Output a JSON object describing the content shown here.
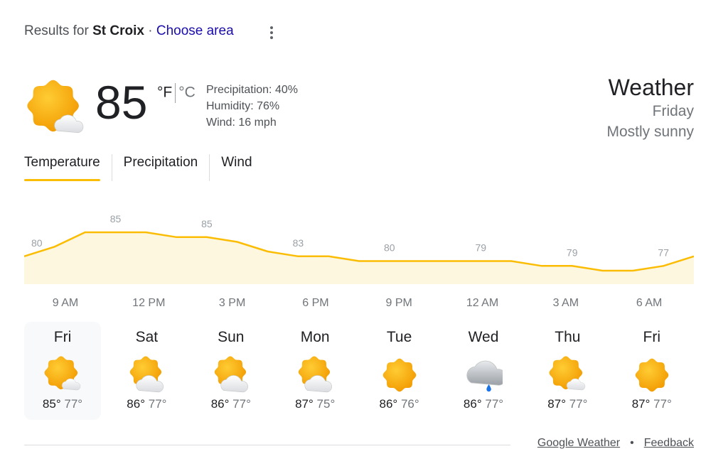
{
  "header": {
    "results_prefix": "Results for",
    "location": "St Croix",
    "separator": "·",
    "choose_area": "Choose area"
  },
  "current": {
    "icon": "partly-sunny-icon",
    "temperature": "85",
    "unit_f": "°F",
    "unit_c": "°C",
    "precipitation": "Precipitation: 40%",
    "humidity": "Humidity: 76%",
    "wind": "Wind: 16 mph"
  },
  "summary": {
    "title": "Weather",
    "day": "Friday",
    "condition": "Mostly sunny"
  },
  "tabs": [
    {
      "label": "Temperature",
      "active": true
    },
    {
      "label": "Precipitation",
      "active": false
    },
    {
      "label": "Wind",
      "active": false
    }
  ],
  "chart_data": {
    "type": "area",
    "values": [
      80,
      82,
      85,
      85,
      85,
      84,
      84,
      83,
      81,
      80,
      80,
      79,
      79,
      79,
      79,
      79,
      79,
      78,
      78,
      77,
      77,
      78,
      80
    ],
    "point_labels": [
      "80",
      "85",
      "85",
      "83",
      "80",
      "79",
      "79",
      "77"
    ],
    "x_tick_labels": [
      "9 AM",
      "12 PM",
      "3 PM",
      "6 PM",
      "9 PM",
      "12 AM",
      "3 AM",
      "6 AM"
    ],
    "ylim": [
      70,
      90
    ],
    "line_color": "#fbbc04",
    "fill_color": "#fef7e0"
  },
  "days": [
    {
      "name": "Fri",
      "icon": "partly-sunny-icon",
      "high": "85°",
      "low": "77°",
      "selected": true
    },
    {
      "name": "Sat",
      "icon": "partly-cloudy-icon",
      "high": "86°",
      "low": "77°",
      "selected": false
    },
    {
      "name": "Sun",
      "icon": "partly-cloudy-icon",
      "high": "86°",
      "low": "77°",
      "selected": false
    },
    {
      "name": "Mon",
      "icon": "partly-cloudy-icon",
      "high": "87°",
      "low": "75°",
      "selected": false
    },
    {
      "name": "Tue",
      "icon": "sunny-icon",
      "high": "86°",
      "low": "76°",
      "selected": false
    },
    {
      "name": "Wed",
      "icon": "rain-cloud-icon",
      "high": "86°",
      "low": "77°",
      "selected": false
    },
    {
      "name": "Thu",
      "icon": "partly-sunny-icon",
      "high": "87°",
      "low": "77°",
      "selected": false
    },
    {
      "name": "Fri",
      "icon": "sunny-icon",
      "high": "87°",
      "low": "77°",
      "selected": false
    }
  ],
  "footer": {
    "source_link": "Google Weather",
    "dot": "•",
    "feedback_link": "Feedback"
  }
}
